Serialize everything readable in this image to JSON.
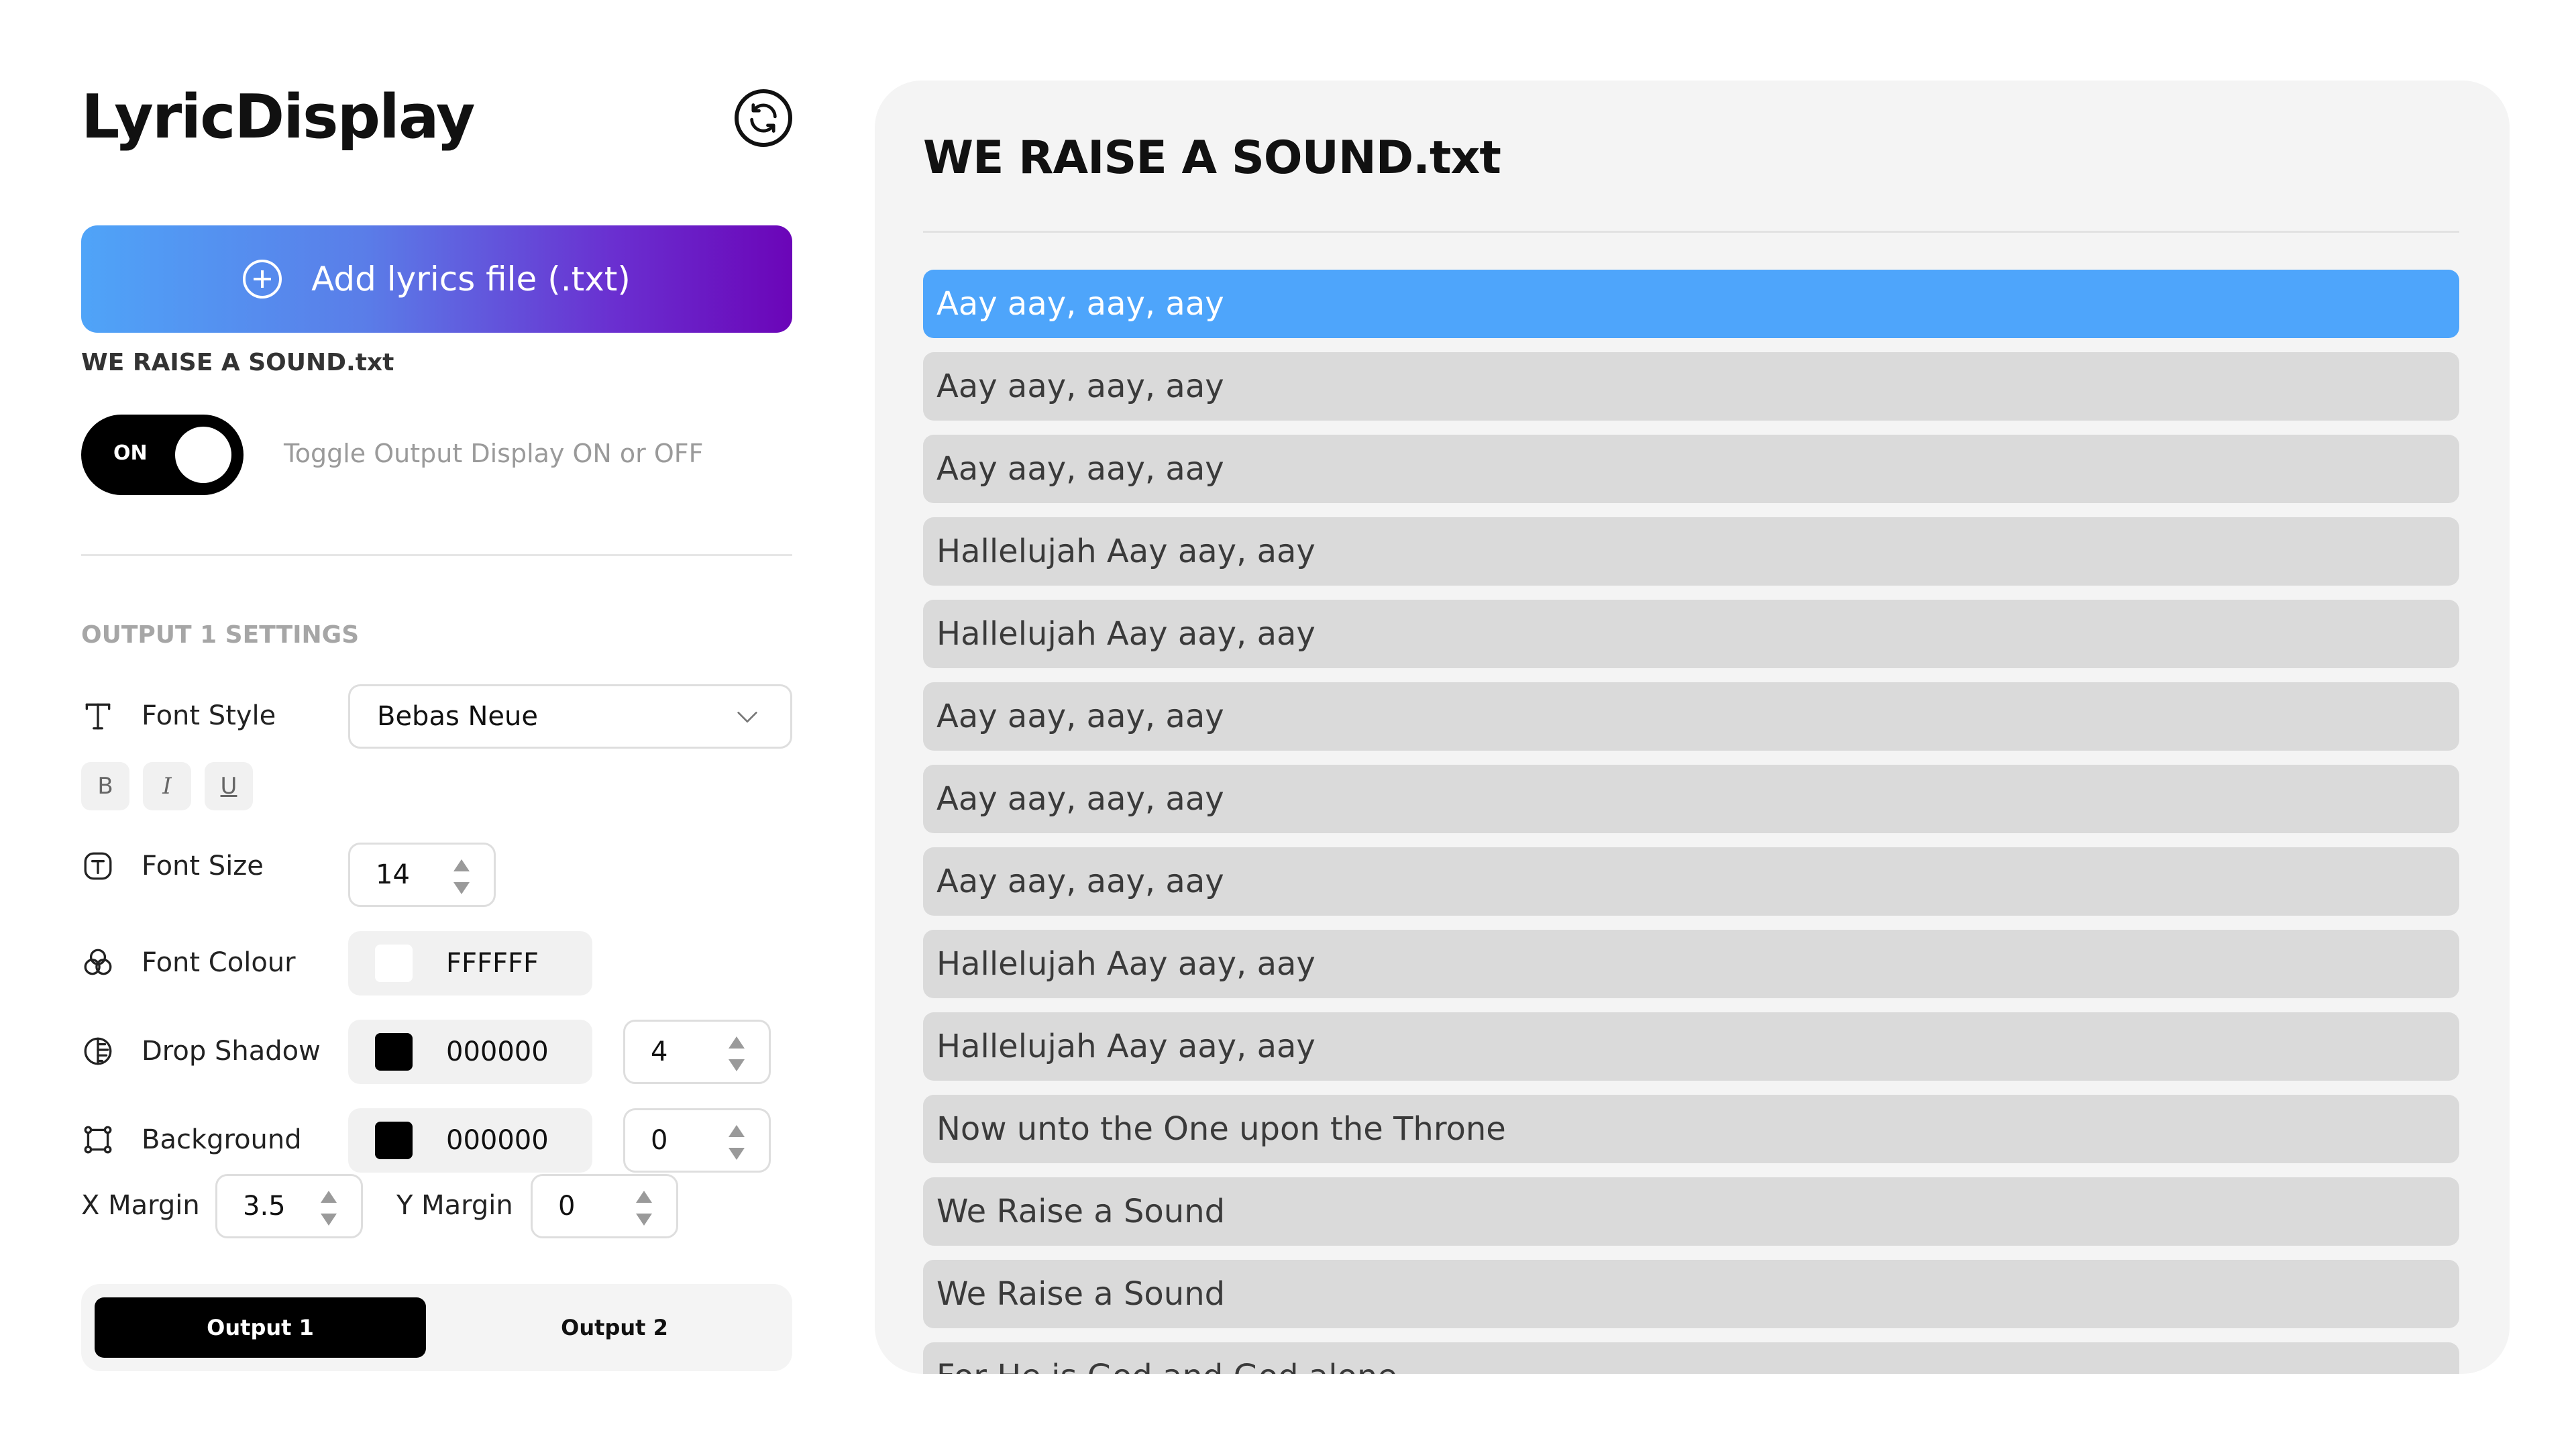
{
  "app": {
    "title": "LyricDisplay"
  },
  "upload": {
    "label": "Add lyrics file (.txt)"
  },
  "file": {
    "name": "WE RAISE A SOUND.txt"
  },
  "output_toggle": {
    "state_label": "ON",
    "hint": "Toggle Output Display ON or OFF"
  },
  "settings": {
    "section_title": "OUTPUT 1 SETTINGS",
    "font_style": {
      "label": "Font Style",
      "value": "Bebas Neue"
    },
    "format_buttons": {
      "bold": "B",
      "italic": "I",
      "underline": "U"
    },
    "font_size": {
      "label": "Font Size",
      "value": "14"
    },
    "font_colour": {
      "label": "Font Colour",
      "value": "FFFFFF",
      "swatch": "#FFFFFF"
    },
    "drop_shadow": {
      "label": "Drop Shadow",
      "color": "000000",
      "swatch": "#000000",
      "amount": "4"
    },
    "background": {
      "label": "Background",
      "color": "000000",
      "swatch": "#000000",
      "amount": "0"
    },
    "x_margin": {
      "label": "X Margin",
      "value": "3.5"
    },
    "y_margin": {
      "label": "Y Margin",
      "value": "0"
    }
  },
  "output_tabs": [
    "Output 1",
    "Output 2"
  ],
  "preview": {
    "title": "WE RAISE A SOUND.txt",
    "selected_index": 0,
    "lines": [
      "Aay aay, aay, aay",
      "Aay aay, aay, aay",
      "Aay aay, aay, aay",
      "Hallelujah Aay aay, aay",
      "Hallelujah Aay aay, aay",
      "Aay aay, aay, aay",
      "Aay aay, aay, aay",
      "Aay aay, aay, aay",
      "Hallelujah Aay aay, aay",
      "Hallelujah Aay aay, aay",
      "Now unto the One upon the Throne",
      "We Raise a Sound",
      "We Raise a Sound",
      "For He is God and God alone"
    ]
  },
  "colors": {
    "accent": "#4ea5fb",
    "gradient_start": "#4fa4f8",
    "gradient_end": "#6b05b8"
  }
}
